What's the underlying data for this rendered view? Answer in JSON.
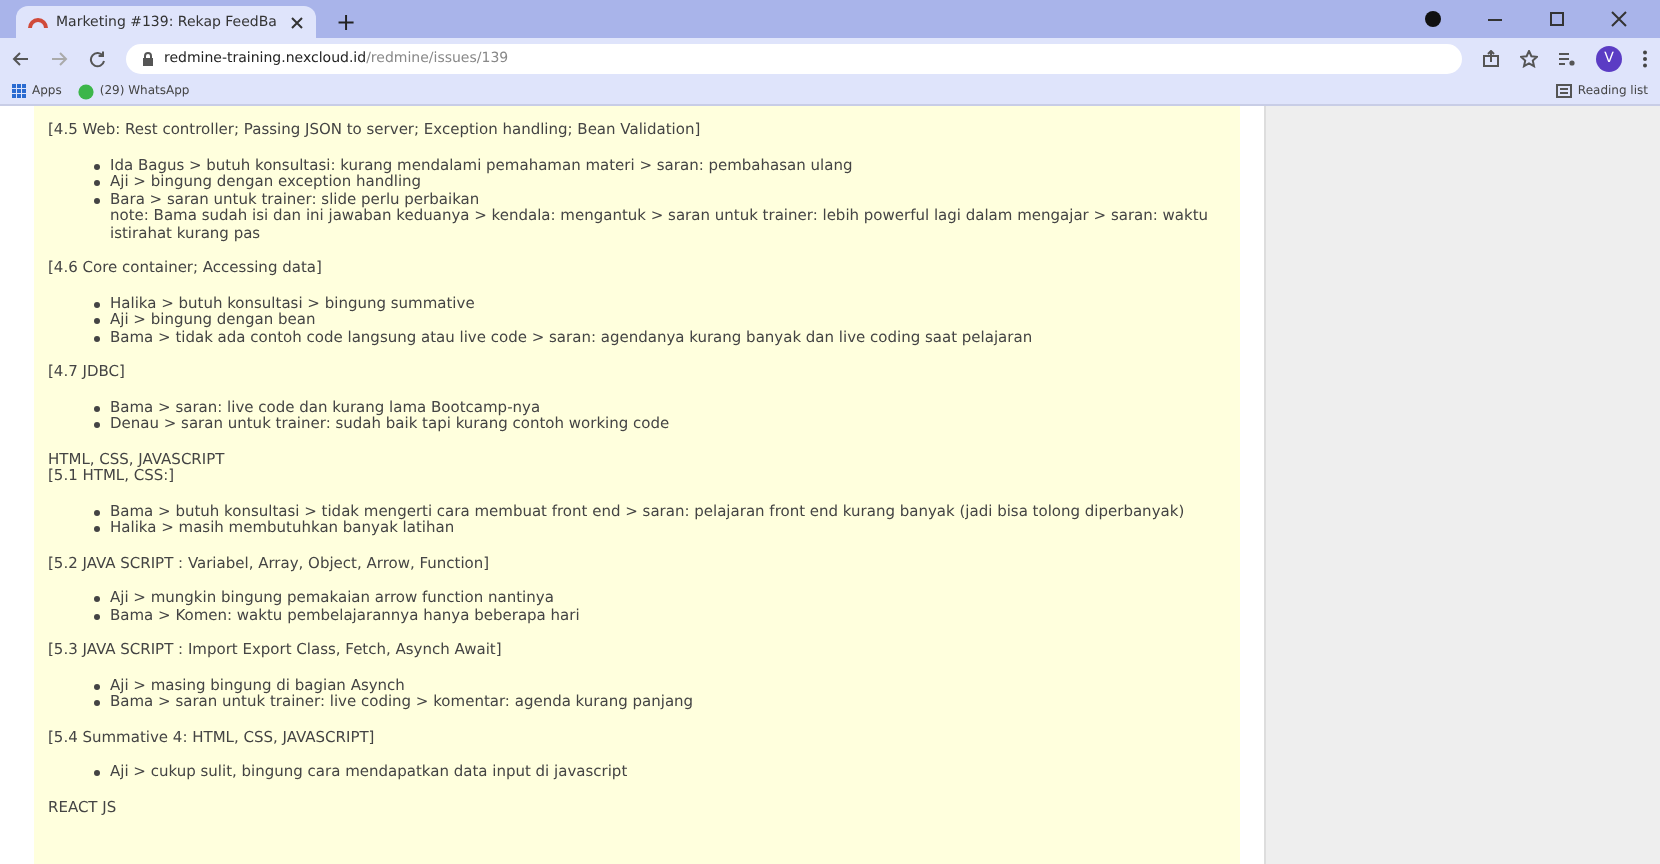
{
  "browser": {
    "tab": {
      "title": "Marketing #139: Rekap FeedBa",
      "selected": true
    },
    "new_tab": "+",
    "url_host": "redmine-training.nexcloud.id",
    "url_path": "/redmine/issues/139",
    "profile": "V",
    "bookmarks": [
      "Apps",
      "(29) WhatsApp"
    ],
    "reading_list": "Reading list"
  },
  "blocks": [
    {
      "kind": "heading",
      "text": "[4.5 Web: Rest controller; Passing JSON to server; Exception handling; Bean Validation]"
    },
    {
      "kind": "list",
      "items": [
        {
          "text": "Ida Bagus > butuh konsultasi: kurang mendalami pemahaman materi > saran: pembahasan ulang"
        },
        {
          "text": "Aji > bingung dengan exception handling"
        },
        {
          "text": "Bara > saran untuk trainer: slide perlu perbaikan",
          "note": "note: Bama sudah isi dan ini jawaban keduanya > kendala: mengantuk > saran untuk trainer: lebih powerful lagi dalam mengajar > saran: waktu istirahat kurang pas"
        }
      ]
    },
    {
      "kind": "heading",
      "text": "[4.6 Core container; Accessing data]"
    },
    {
      "kind": "list",
      "items": [
        {
          "text": "Halika > butuh konsultasi > bingung summative"
        },
        {
          "text": "Aji > bingung dengan bean"
        },
        {
          "text": "Bama > tidak ada contoh code langsung atau live code > saran: agendanya kurang banyak dan live coding saat pelajaran"
        }
      ]
    },
    {
      "kind": "heading",
      "text": "[4.7 JDBC]"
    },
    {
      "kind": "list",
      "items": [
        {
          "text": "Bama > saran: live code dan kurang lama Bootcamp-nya"
        },
        {
          "text": "Denau > saran untuk trainer: sudah baik tapi kurang contoh working code"
        }
      ]
    },
    {
      "kind": "plain",
      "text": "HTML, CSS, JAVASCRIPT"
    },
    {
      "kind": "heading",
      "text": "[5.1 HTML, CSS:]"
    },
    {
      "kind": "list",
      "items": [
        {
          "text": "Bama > butuh konsultasi > tidak mengerti cara membuat front end > saran: pelajaran front end kurang banyak (jadi bisa tolong diperbanyak)"
        },
        {
          "text": "Halika > masih membutuhkan banyak latihan"
        }
      ]
    },
    {
      "kind": "heading",
      "text": "[5.2 JAVA SCRIPT : Variabel, Array, Object, Arrow, Function]"
    },
    {
      "kind": "list",
      "items": [
        {
          "text": "Aji > mungkin bingung pemakaian arrow function nantinya"
        },
        {
          "text": "Bama > Komen: waktu pembelajarannya hanya beberapa hari"
        }
      ]
    },
    {
      "kind": "heading",
      "text": "[5.3 JAVA SCRIPT : Import Export Class, Fetch, Asynch Await]"
    },
    {
      "kind": "list",
      "items": [
        {
          "text": "Aji > masing bingung di bagian Asynch"
        },
        {
          "text": "Bama > saran untuk trainer: live coding > komentar: agenda kurang panjang"
        }
      ]
    },
    {
      "kind": "heading",
      "text": "[5.4 Summative 4: HTML, CSS, JAVASCRIPT]"
    },
    {
      "kind": "list",
      "items": [
        {
          "text": "Aji > cukup sulit, bingung cara mendapatkan data input di javascript"
        }
      ]
    },
    {
      "kind": "plain",
      "text": "REACT JS"
    }
  ]
}
